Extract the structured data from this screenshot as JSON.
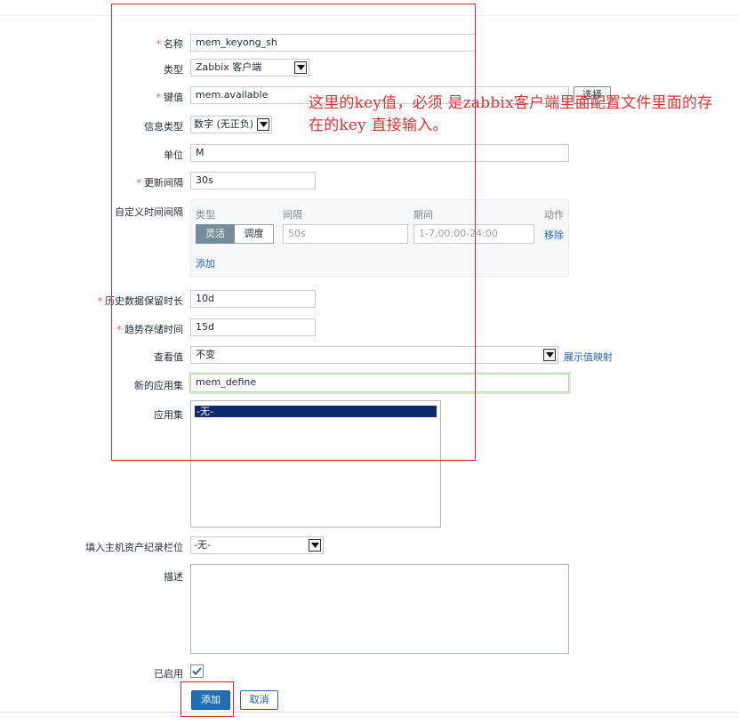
{
  "form": {
    "name": {
      "label": "名称",
      "value": "mem_keyong_sh"
    },
    "type": {
      "label": "类型",
      "value": "Zabbix 客户端"
    },
    "key": {
      "label": "键值",
      "value": "mem.available",
      "select_button": "选择"
    },
    "info_type": {
      "label": "信息类型",
      "value": "数字 (无正负)"
    },
    "units": {
      "label": "单位",
      "value": "M"
    },
    "update_interval": {
      "label": "更新间隔",
      "value": "30s"
    },
    "custom_intervals": {
      "label": "自定义时间间隔",
      "headers": {
        "type": "类型",
        "interval": "间隔",
        "period": "期间",
        "action": "动作"
      },
      "seg_flexible": "灵活",
      "seg_scheduling": "调度",
      "interval_placeholder": "50s",
      "period_placeholder": "1-7,00:00-24:00",
      "remove_link": "移除",
      "add_link": "添加"
    },
    "history": {
      "label": "历史数据保留时长",
      "value": "10d"
    },
    "trends": {
      "label": "趋势存储时间",
      "value": "15d"
    },
    "show_value": {
      "label": "查看值",
      "value": "不变",
      "mapping_link": "展示值映射"
    },
    "new_application": {
      "label": "新的应用集",
      "value": "mem_define"
    },
    "applications": {
      "label": "应用集",
      "options": [
        "-无-"
      ]
    },
    "inventory_field": {
      "label": "填入主机资产纪录栏位",
      "value": "-无-"
    },
    "description": {
      "label": "描述",
      "value": ""
    },
    "enabled": {
      "label": "已启用",
      "checked": true
    }
  },
  "buttons": {
    "add": "添加",
    "cancel": "取消"
  },
  "annotation": {
    "text": "这里的key值，必须 是zabbix客户端里面配置文件里面的存在的key      直接输入。",
    "color": "#e03131"
  },
  "required_mark": "*",
  "colors": {
    "accent": "#1f6fb5",
    "link": "#1f65b4",
    "annotation_border": "#e0262e",
    "required": "#e45959"
  }
}
